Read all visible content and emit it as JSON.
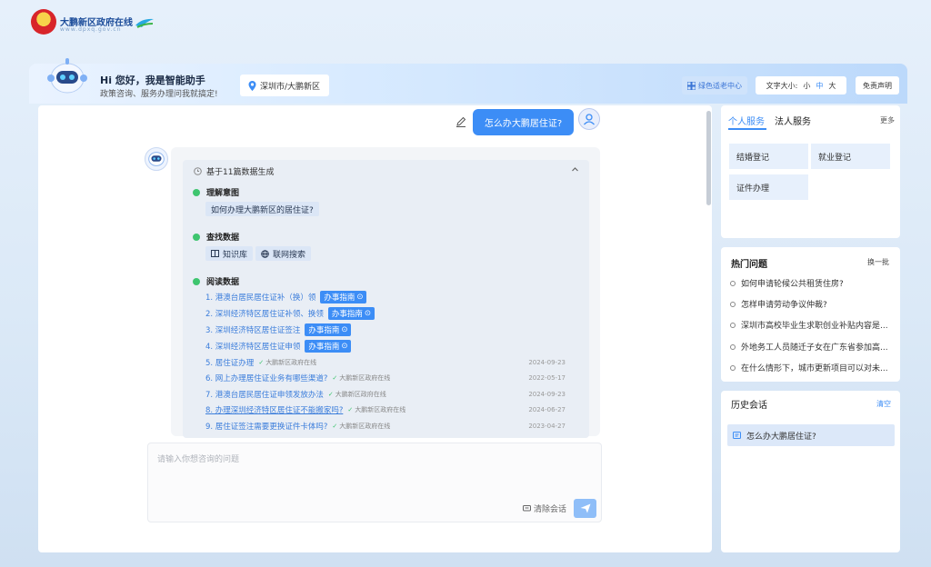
{
  "site": {
    "title": "大鹏新区政府在线",
    "subtitle": "www.dpxq.gov.cn"
  },
  "header": {
    "greeting": "Hi 您好，我是智能助手",
    "greeting_sub": "政策咨询、服务办理问我就搞定!",
    "location": "深圳市/大鹏新区",
    "accessible_label": "绿色适老中心",
    "font_size_label": "文字大小:",
    "font_sizes": [
      "小",
      "中",
      "大"
    ],
    "disclaimer_label": "免责声明"
  },
  "chat": {
    "user_question": "怎么办大鹏居住证?",
    "generated_from": "基于11篇数据生成",
    "steps": {
      "understand": "理解意图",
      "understand_query": "如何办理大鹏新区的居住证?",
      "search": "查找数据",
      "search_chips": [
        "知识库",
        "联网搜索"
      ],
      "read": "阅读数据"
    },
    "guide_label": "办事指南",
    "source_name": "大鹏新区政府在线",
    "results": [
      {
        "text": "1. 港澳台居民居住证补（换）领",
        "guide": true
      },
      {
        "text": "2. 深圳经济特区居住证补领、换领",
        "guide": true
      },
      {
        "text": "3. 深圳经济特区居住证签注",
        "guide": true
      },
      {
        "text": "4. 深圳经济特区居住证申领",
        "guide": true
      },
      {
        "text": "5. 居住证办理",
        "source": true,
        "date": "2024-09-23"
      },
      {
        "text": "6. 网上办理居住证业务有哪些渠道?",
        "source": true,
        "date": "2022-05-17"
      },
      {
        "text": "7. 港澳台居民居住证申领发放办法",
        "source": true,
        "date": "2024-09-23"
      },
      {
        "text": "8. 办理深圳经济特区居住证不能搬家吗?",
        "source": true,
        "date": "2024-06-27",
        "underline": true
      },
      {
        "text": "9. 居住证签注需要更换证件卡体吗?",
        "source": true,
        "date": "2023-04-27"
      }
    ],
    "input_placeholder": "请输入你想咨询的问题",
    "clear_label": "清除会话"
  },
  "services": {
    "tab_personal": "个人服务",
    "tab_legal": "法人服务",
    "more": "更多",
    "items": [
      "结婚登记",
      "就业登记",
      "证件办理"
    ]
  },
  "hot": {
    "title": "热门问题",
    "refresh": "换一批",
    "questions": [
      "如何申请轮候公共租赁住房?",
      "怎样申请劳动争议仲裁?",
      "深圳市高校毕业生求职创业补贴内容是...",
      "外地务工人员随迁子女在广东省参加高...",
      "在什么情形下，城市更新项目可以对未..."
    ]
  },
  "history": {
    "title": "历史会话",
    "clear": "清空",
    "items": [
      "怎么办大鹏居住证?"
    ]
  },
  "colors": {
    "accent": "#3c8df6",
    "link": "#3b7ddb",
    "success": "#3ec56f"
  }
}
